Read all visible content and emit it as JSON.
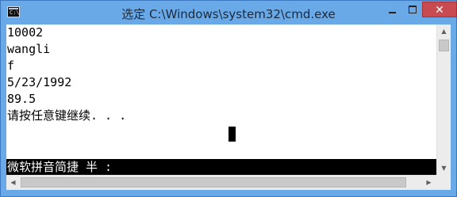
{
  "window": {
    "title": "选定 C:\\Windows\\system32\\cmd.exe",
    "icon": "cmd-console-icon",
    "app_icon_prompt": "C:\\",
    "controls": {
      "minimize_icon": "minimize-icon",
      "maximize_icon": "maximize-icon",
      "close_label": "✕"
    }
  },
  "console": {
    "lines": [
      "10002",
      "wangli",
      "f",
      "5/23/1992",
      "89.5",
      "请按任意键继续. . ."
    ],
    "ime_status": "微软拼音简捷 半 :"
  },
  "scrollbars": {
    "up_arrow": "▲",
    "down_arrow": "▼",
    "left_arrow": "◀",
    "right_arrow": "▶"
  },
  "colors": {
    "titlebar": "#6aa9e8",
    "close_button": "#c74b50",
    "console_bg": "#ffffff",
    "console_fg": "#000000",
    "ime_bar_bg": "#000000",
    "ime_bar_fg": "#ffffff"
  }
}
